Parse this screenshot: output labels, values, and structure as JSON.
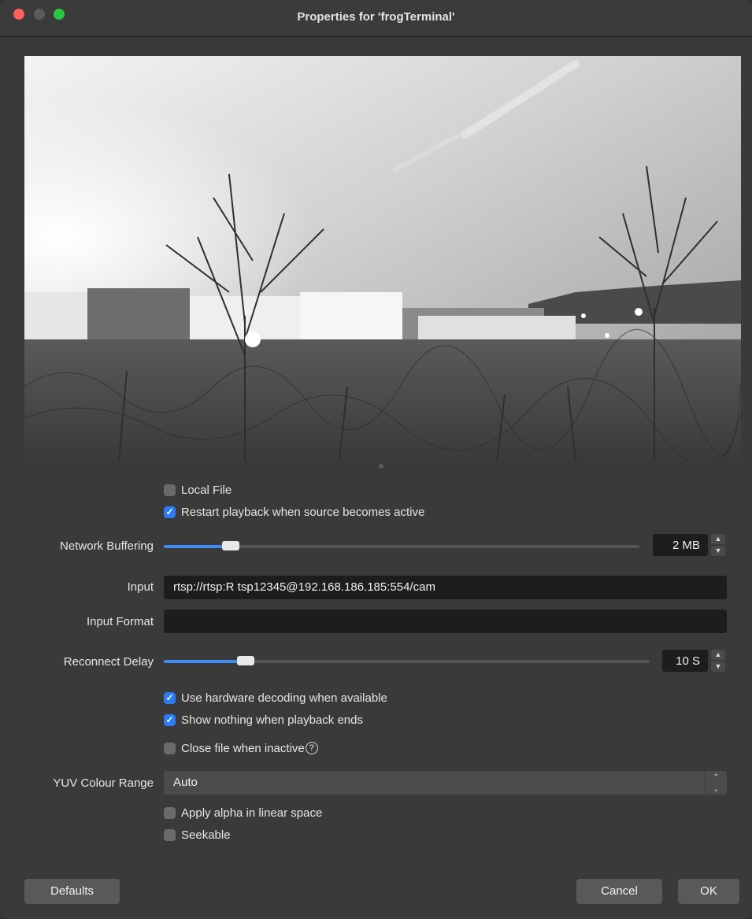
{
  "window": {
    "title": "Properties for 'frogTerminal'"
  },
  "options_top": [
    {
      "label": "Local File",
      "checked": false
    },
    {
      "label": "Restart playback when source becomes active",
      "checked": true
    }
  ],
  "network_buffering": {
    "label": "Network Buffering",
    "value": "2 MB",
    "slider_fraction": 0.14
  },
  "input": {
    "label": "Input",
    "value": "rtsp://rtsp:R tsp12345@192.168.186.185:554/cam"
  },
  "input_format": {
    "label": "Input Format",
    "value": ""
  },
  "reconnect_delay": {
    "label": "Reconnect Delay",
    "value": "10 S",
    "slider_fraction": 0.17
  },
  "options_middle": [
    {
      "label": "Use hardware decoding when available",
      "checked": true
    },
    {
      "label": "Show nothing when playback ends",
      "checked": true
    },
    {
      "label": "Close file when inactive",
      "checked": false
    }
  ],
  "yuv_colour_range": {
    "label": "YUV Colour Range",
    "selected": "Auto"
  },
  "options_bottom": [
    {
      "label": "Apply alpha in linear space",
      "checked": false
    },
    {
      "label": "Seekable",
      "checked": false
    }
  ],
  "buttons": {
    "defaults": "Defaults",
    "cancel": "Cancel",
    "ok": "OK"
  },
  "colors": {
    "accent": "#2d7cf6",
    "background": "#3a3a3a",
    "field": "#1d1d1d"
  },
  "icons": {
    "checkmark": "checkmark-icon",
    "help": "help-icon",
    "spin_up": "chevron-up-icon",
    "spin_down": "chevron-down-icon",
    "select": "up-down-chevron-icon"
  }
}
